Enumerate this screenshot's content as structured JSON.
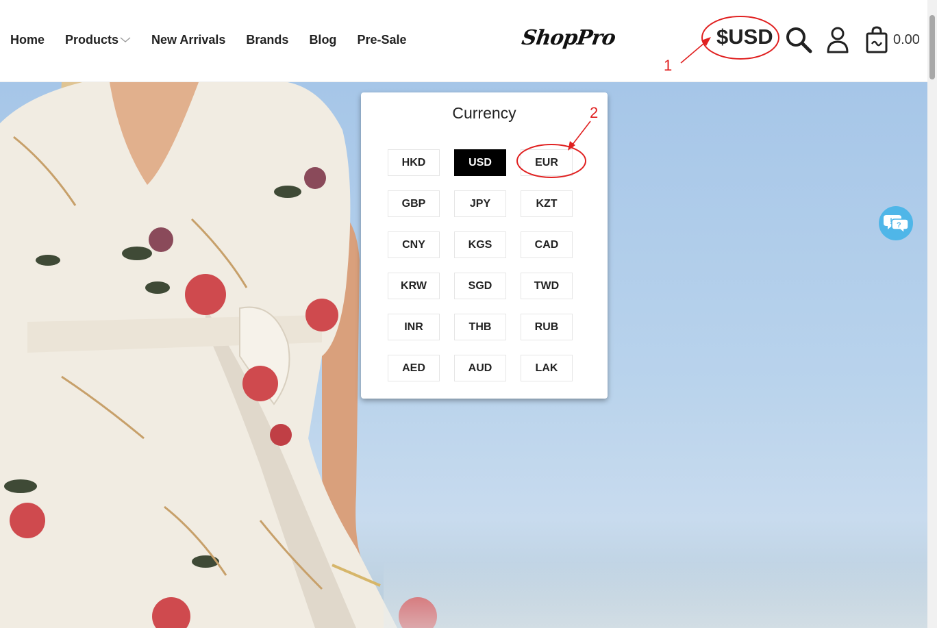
{
  "header": {
    "nav": [
      {
        "label": "Home"
      },
      {
        "label": "Products",
        "has_dropdown": true
      },
      {
        "label": "New Arrivals"
      },
      {
        "label": "Brands"
      },
      {
        "label": "Blog"
      },
      {
        "label": "Pre-Sale"
      }
    ],
    "logo": "ShopPro",
    "currency_label": "$USD",
    "cart_total": "0.00",
    "icons": [
      "search-icon",
      "user-icon",
      "shopping-bag-icon"
    ]
  },
  "currency_popup": {
    "title": "Currency",
    "selected": "USD",
    "options": [
      "HKD",
      "USD",
      "EUR",
      "GBP",
      "JPY",
      "KZT",
      "CNY",
      "KGS",
      "CAD",
      "KRW",
      "SGD",
      "TWD",
      "INR",
      "THB",
      "RUB",
      "AED",
      "AUD",
      "LAK"
    ]
  },
  "annotations": [
    {
      "number": "1",
      "target": "currency-button"
    },
    {
      "number": "2",
      "target": "currency-option-EUR"
    }
  ],
  "chat_widget": {
    "icon": "chat-bubble-icon"
  },
  "colors": {
    "annotation_red": "#e02020",
    "selected_bg": "#000000",
    "chat_blue": "#4fb6e8"
  }
}
